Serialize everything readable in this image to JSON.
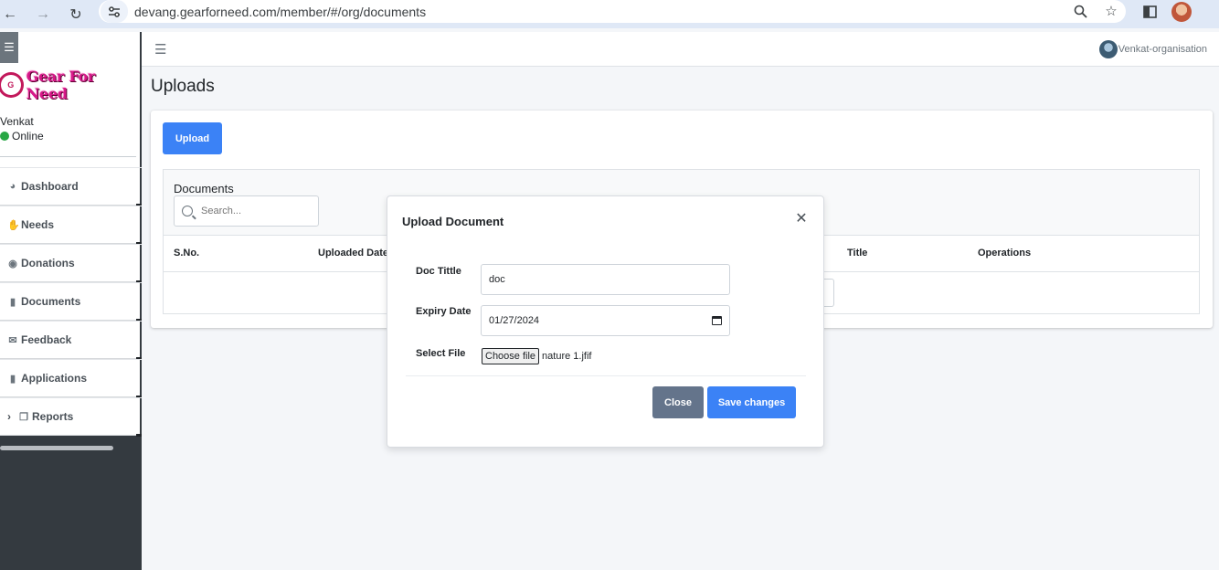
{
  "browser": {
    "url": "devang.gearforneed.com/member/#/org/documents",
    "icons": [
      "back-icon",
      "forward-icon",
      "reload-icon",
      "site-info-icon",
      "zoom-icon",
      "bookmark-star-icon",
      "side-panel-icon",
      "profile-avatar"
    ]
  },
  "brand": {
    "name": "Gear For Need",
    "color": "#d8198a"
  },
  "user": {
    "name": "Venkat",
    "status": "Online",
    "status_color": "#28a745"
  },
  "sidebar": {
    "items": [
      {
        "label": "Dashboard",
        "icon": "dashboard-icon"
      },
      {
        "label": "Needs",
        "icon": "hand-icon"
      },
      {
        "label": "Donations",
        "icon": "donate-icon"
      },
      {
        "label": "Documents",
        "icon": "file-icon"
      },
      {
        "label": "Feedback",
        "icon": "envelope-icon"
      },
      {
        "label": "Applications",
        "icon": "file-icon"
      },
      {
        "label": "Reports",
        "icon": "copy-icon"
      }
    ]
  },
  "topbar": {
    "org_user": "Venkat-organisation"
  },
  "page": {
    "title": "Uploads"
  },
  "card": {
    "upload_label": "Upload",
    "table_title": "Documents",
    "search_placeholder": "Search...",
    "columns": [
      "S.No.",
      "Uploaded Date",
      "Title",
      "Operations"
    ]
  },
  "modal": {
    "title": "Upload Document",
    "fields": {
      "doc_title_label": "Doc Tittle",
      "doc_title_value": "doc",
      "expiry_label": "Expiry Date",
      "expiry_value": "01/27/2024",
      "file_label": "Select File",
      "choose_file": "Choose file",
      "file_name": "nature 1.jfif"
    },
    "close_label": "Close",
    "save_label": "Save changes"
  },
  "colors": {
    "primary": "#3b82f6",
    "secondary": "#64748b",
    "sidebar_dark": "#343a40"
  }
}
